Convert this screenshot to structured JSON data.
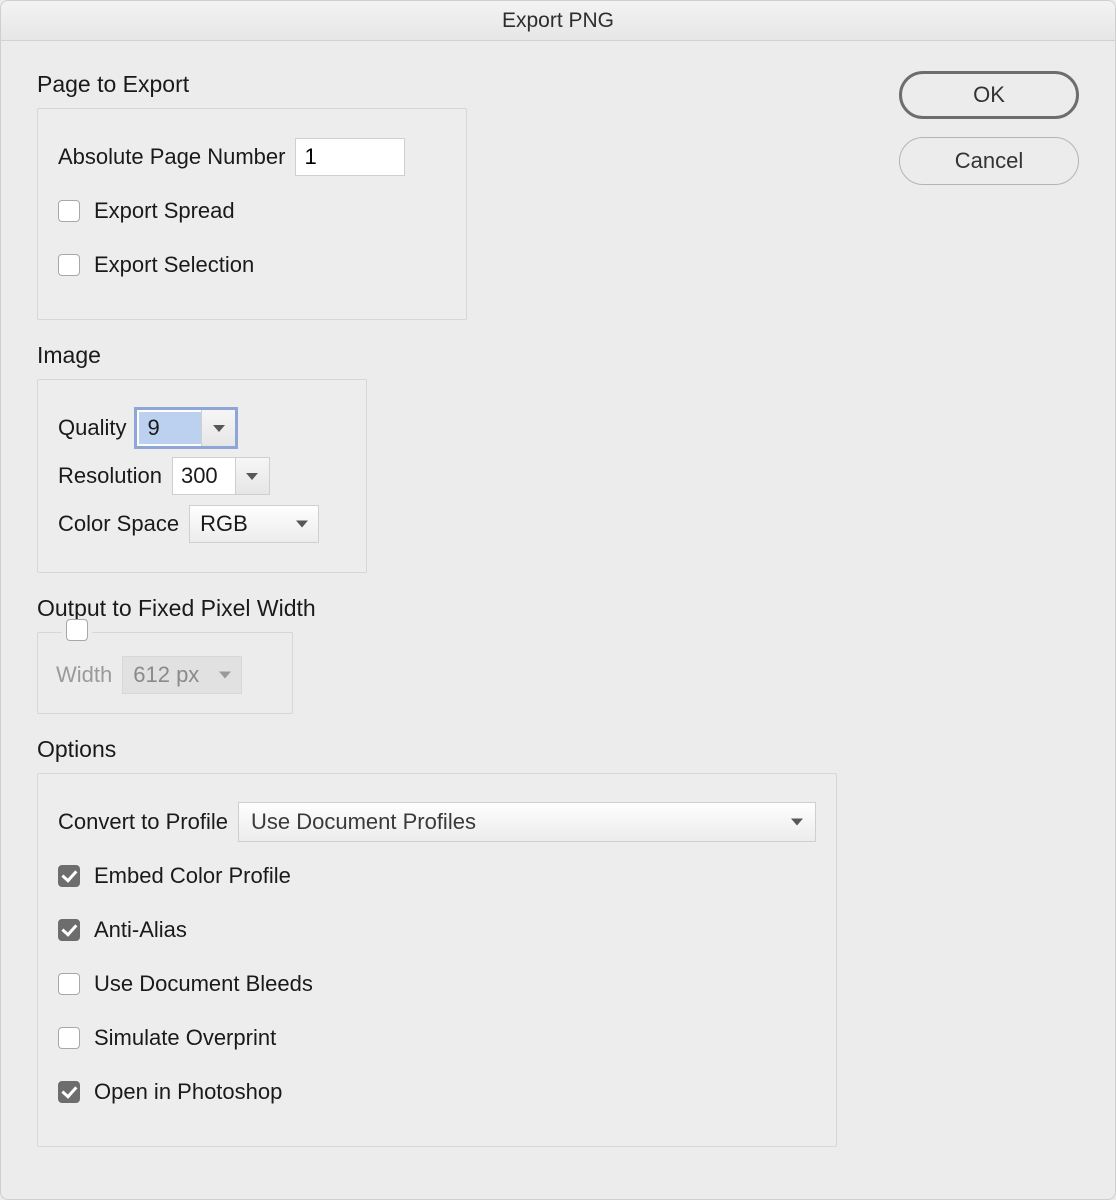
{
  "title": "Export PNG",
  "buttons": {
    "ok": "OK",
    "cancel": "Cancel"
  },
  "page_to_export": {
    "heading": "Page to Export",
    "abs_page_label": "Absolute Page Number",
    "abs_page_value": "1",
    "export_spread": "Export Spread",
    "export_selection": "Export Selection"
  },
  "image": {
    "heading": "Image",
    "quality_label": "Quality",
    "quality_value": "9",
    "resolution_label": "Resolution",
    "resolution_value": "300",
    "color_space_label": "Color Space",
    "color_space_value": "RGB"
  },
  "fixed_width": {
    "heading": "Output to Fixed Pixel Width",
    "width_label": "Width",
    "width_value": "612 px"
  },
  "options": {
    "heading": "Options",
    "convert_label": "Convert to Profile",
    "convert_value": "Use Document Profiles",
    "embed": "Embed Color Profile",
    "anti_alias": "Anti-Alias",
    "bleeds": "Use Document Bleeds",
    "overprint": "Simulate Overprint",
    "open_ps": "Open in Photoshop"
  }
}
